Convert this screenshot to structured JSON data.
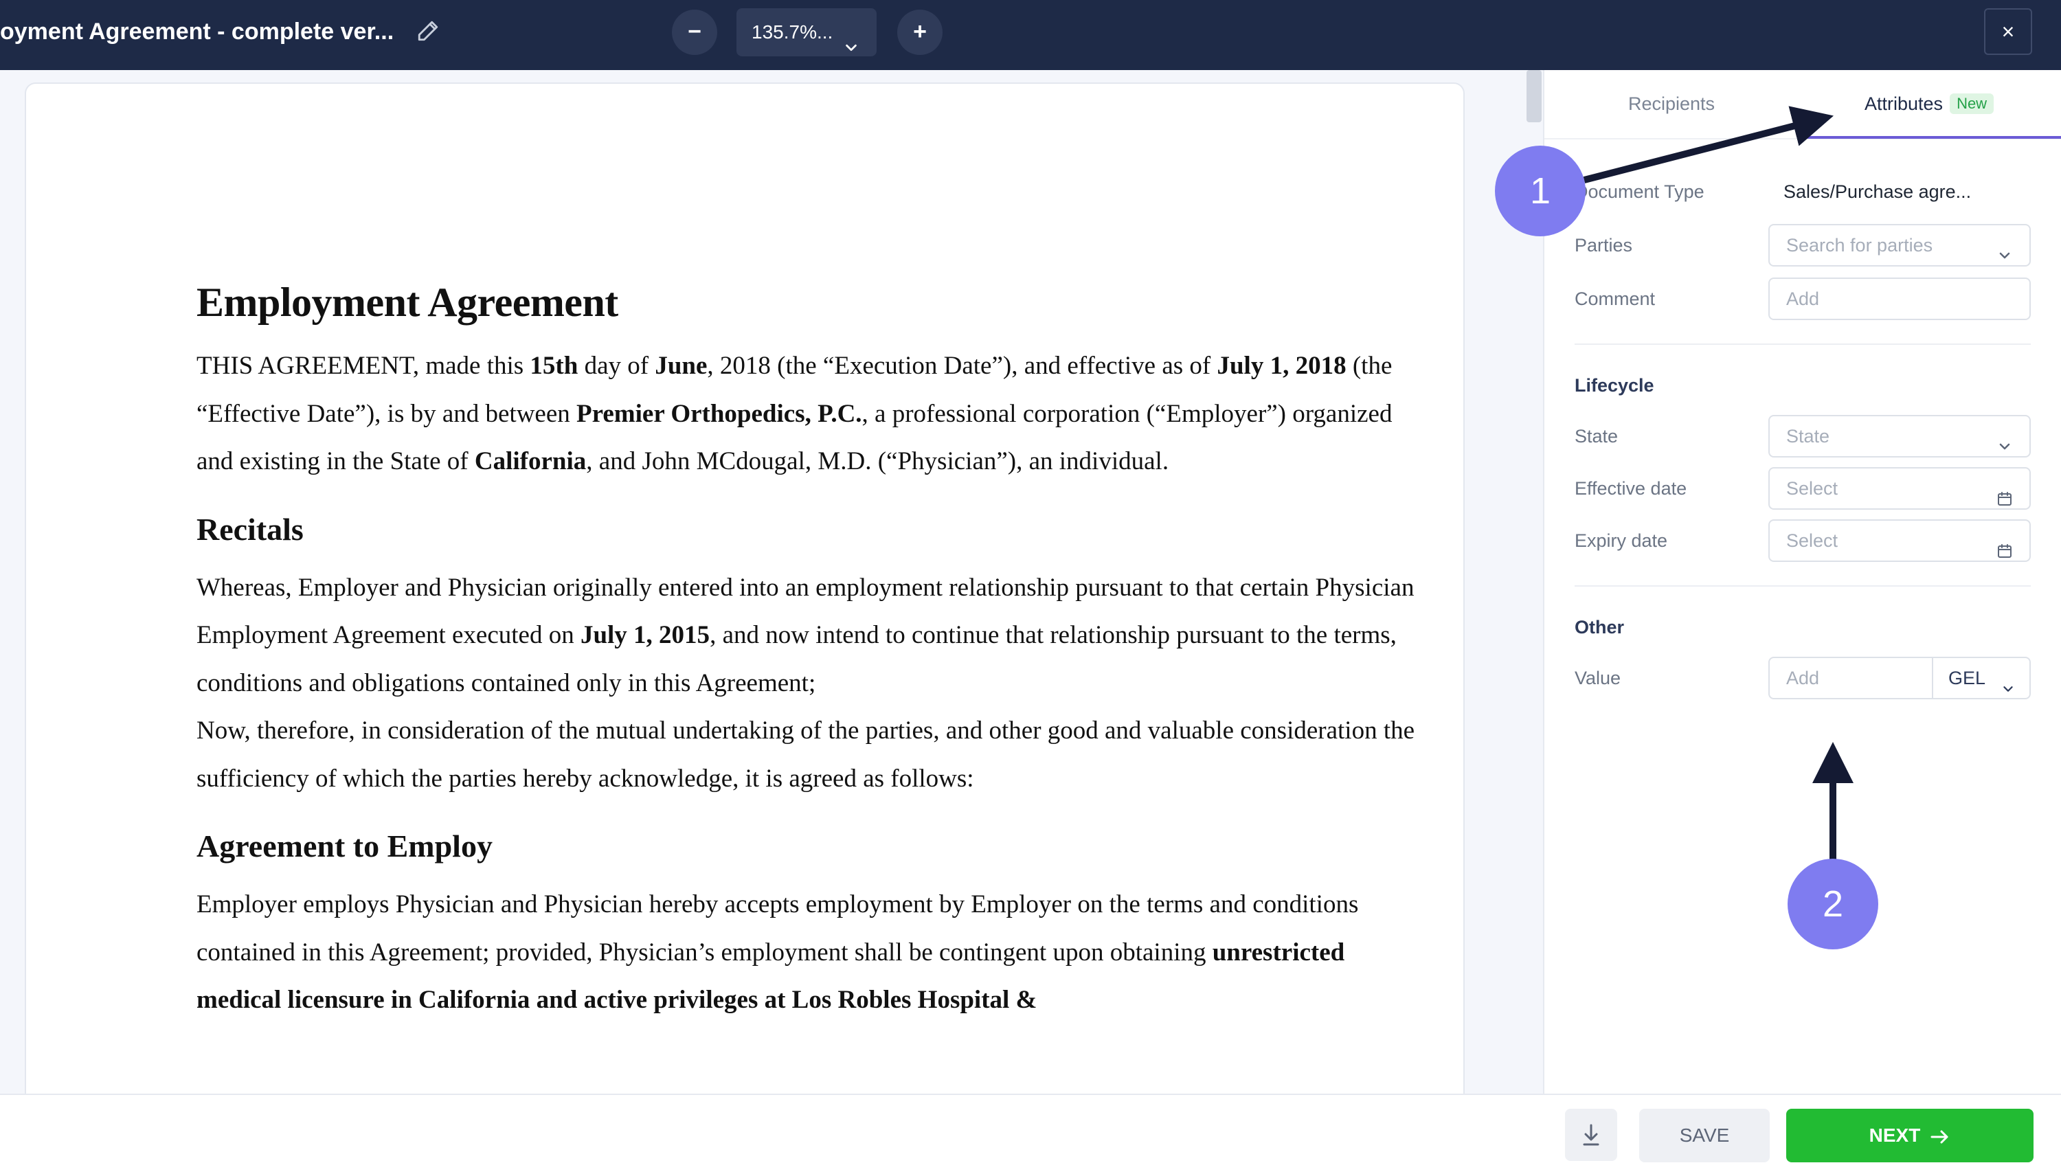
{
  "header": {
    "title": "oyment Agreement - complete ver...",
    "zoom_out": "−",
    "zoom_level": "135.7%...",
    "zoom_in": "+",
    "close": "×",
    "bg_color": "#1e2a47"
  },
  "document": {
    "title": "Employment Agreement",
    "p1": [
      {
        "t": "THIS AGREEMENT, made this "
      },
      {
        "t": "15th",
        "b": true
      },
      {
        "t": " day of "
      },
      {
        "t": "June",
        "b": true
      },
      {
        "t": ", 2018 (the “Execution Date”), and effective as of "
      },
      {
        "t": "July 1, 2018",
        "b": true
      },
      {
        "t": " (the “Effective Date”), is by and between "
      },
      {
        "t": "Premier Orthopedics, P.C.",
        "b": true
      },
      {
        "t": ", a professional corporation (“Employer”) organized and existing in the State of "
      },
      {
        "t": "California",
        "b": true
      },
      {
        "t": ", and John MCdougal, M.D. (“Physician”), an individual."
      }
    ],
    "h_recitals": "Recitals",
    "p2": [
      {
        "t": "Whereas, Employer and Physician originally entered into an employment relationship pursuant to that certain Physician Employment Agreement executed on "
      },
      {
        "t": "July 1, 2015",
        "b": true
      },
      {
        "t": ", and now intend to continue that relationship pursuant to the terms, conditions and obligations contained only in this Agreement;"
      }
    ],
    "p3": [
      {
        "t": "Now, therefore, in consideration of the mutual undertaking of the parties, and other good and valuable consideration the sufficiency of which the parties hereby acknowledge, it is agreed as follows:"
      }
    ],
    "h_employ": "Agreement to Employ",
    "p4": [
      {
        "t": "Employer employs Physician and Physician hereby accepts employment by Employer on the terms and conditions contained in this Agreement; provided, Physician’s employment shall be contingent upon obtaining "
      },
      {
        "t": "unrestricted medical licensure in California and active privileges at Los Robles Hospital &",
        "b": true
      }
    ]
  },
  "panel": {
    "tabs": [
      {
        "label": "Recipients",
        "active": false
      },
      {
        "label": "Attributes",
        "active": true,
        "badge": "New"
      }
    ],
    "document_type_label": "Document Type",
    "document_type_value": "Sales/Purchase agre...",
    "parties_label": "Parties",
    "parties_placeholder": "Search for parties",
    "comment_label": "Comment",
    "comment_placeholder": "Add",
    "lifecycle_heading": "Lifecycle",
    "state_label": "State",
    "state_placeholder": "State",
    "effective_label": "Effective date",
    "effective_placeholder": "Select",
    "expiry_label": "Expiry date",
    "expiry_placeholder": "Select",
    "other_heading": "Other",
    "value_label": "Value",
    "value_placeholder": "Add",
    "currency": "GEL"
  },
  "footer": {
    "save_label": "SAVE",
    "next_label": "NEXT",
    "next_color": "#22bb33"
  },
  "annotations": {
    "marker_1": "1",
    "marker_2": "2",
    "marker_color": "#7f7cf0",
    "arrow_color": "#141a33"
  }
}
